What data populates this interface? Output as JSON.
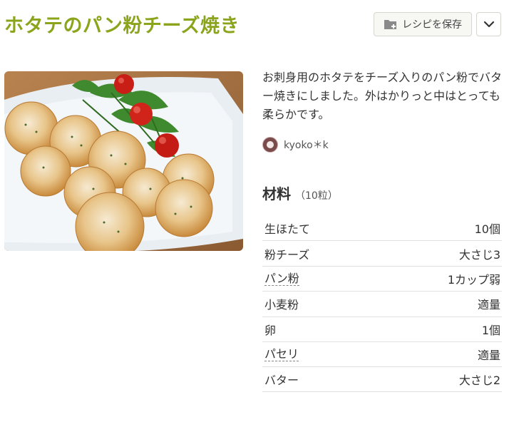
{
  "recipe": {
    "title": "ホタテのパン粉チーズ焼き",
    "description": "お刺身用のホタテをチーズ入りのパン粉でバター焼きにしました。外はかりっと中はとっても柔らかです。",
    "author": "kyoko＊k"
  },
  "toolbar": {
    "save_label": "レシピを保存",
    "save_icon": "folder-plus-icon",
    "menu_icon": "chevron-down-icon"
  },
  "ingredients": {
    "heading": "材料",
    "servings": "（10粒）",
    "items": [
      {
        "name": "生ほたて",
        "amount": "10個",
        "linked": false
      },
      {
        "name": "粉チーズ",
        "amount": "大さじ3",
        "linked": false
      },
      {
        "name": "パン粉",
        "amount": "1カップ弱",
        "linked": true
      },
      {
        "name": "小麦粉",
        "amount": "適量",
        "linked": false
      },
      {
        "name": "卵",
        "amount": "1個",
        "linked": false
      },
      {
        "name": "パセリ",
        "amount": "適量",
        "linked": true
      },
      {
        "name": "バター",
        "amount": "大さじ2",
        "linked": false
      }
    ]
  },
  "colors": {
    "title": "#8aa51c",
    "border": "#e2e2e2"
  }
}
